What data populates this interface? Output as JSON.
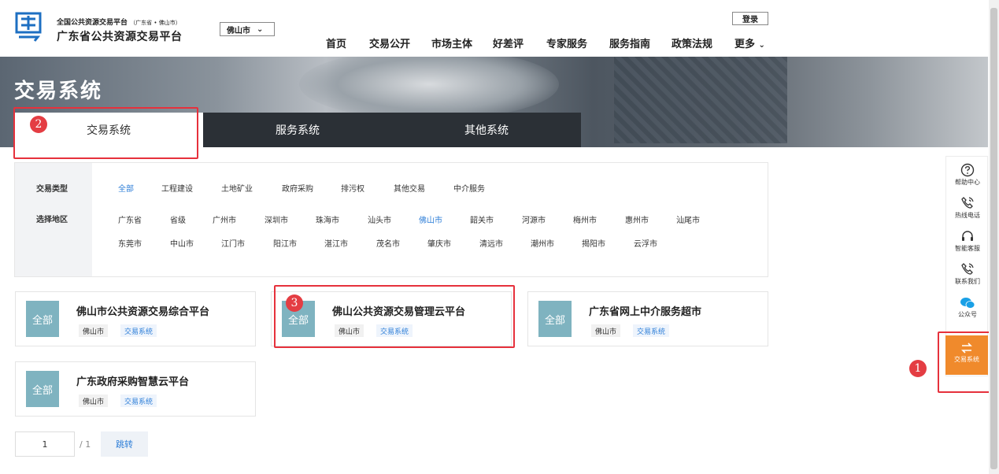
{
  "header": {
    "platform_sub": "全国公共资源交易平台",
    "platform_sub_region": "（广东省 • 佛山市）",
    "platform_title": "广东省公共资源交易平台",
    "city_selected": "佛山市",
    "login_label": "登录",
    "nav": [
      "首页",
      "交易公开",
      "市场主体",
      "好差评",
      "专家服务",
      "服务指南",
      "政策法规",
      "更多"
    ]
  },
  "banner": {
    "title": "交易系统",
    "tabs": [
      "交易系统",
      "服务系统",
      "其他系统"
    ]
  },
  "filter": {
    "type_label": "交易类型",
    "types": [
      "全部",
      "工程建设",
      "土地矿业",
      "政府采购",
      "排污权",
      "其他交易",
      "中介服务"
    ],
    "region_label": "选择地区",
    "regions_row1": [
      "广东省",
      "省级",
      "广州市",
      "深圳市",
      "珠海市",
      "汕头市",
      "佛山市",
      "韶关市",
      "河源市",
      "梅州市",
      "惠州市",
      "汕尾市"
    ],
    "regions_row2": [
      "东莞市",
      "中山市",
      "江门市",
      "阳江市",
      "湛江市",
      "茂名市",
      "肇庆市",
      "清远市",
      "潮州市",
      "揭阳市",
      "云浮市"
    ]
  },
  "cards": [
    {
      "badge": "全部",
      "title": "佛山市公共资源交易综合平台",
      "tag_city": "佛山市",
      "tag_type": "交易系统"
    },
    {
      "badge": "全部",
      "title": "佛山公共资源交易管理云平台",
      "tag_city": "佛山市",
      "tag_type": "交易系统"
    },
    {
      "badge": "全部",
      "title": "广东省网上中介服务超市",
      "tag_city": "佛山市",
      "tag_type": "交易系统"
    },
    {
      "badge": "全部",
      "title": "广东政府采购智慧云平台",
      "tag_city": "佛山市",
      "tag_type": "交易系统"
    }
  ],
  "pager": {
    "current": "1",
    "total": "/ 1",
    "jump_label": "跳转"
  },
  "sidebar": {
    "items": [
      "帮助中心",
      "热线电话",
      "智能客服",
      "联系我们",
      "公众号"
    ],
    "active": "交易系统"
  },
  "annotations": [
    "1",
    "2",
    "3"
  ],
  "colors": {
    "accent_blue": "#2f7fd8",
    "badge_teal": "#7fb3c0",
    "side_orange": "#f08a2c",
    "annotation_red": "#e6313c"
  }
}
